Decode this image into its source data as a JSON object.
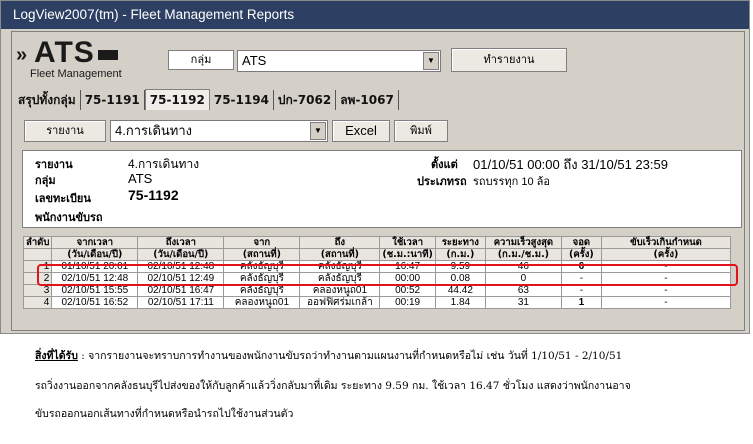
{
  "window": {
    "title": "LogView2007(tm) - Fleet Management Reports"
  },
  "logo": {
    "brand": "ATS",
    "subtitle": "Fleet Management"
  },
  "toolbar": {
    "group_label": "กลุ่ม",
    "group_value": "ATS",
    "make_report_label": "ทำรายงาน",
    "report_label": "รายงาน",
    "report_value": "4.การเดินทาง",
    "excel_label": "Excel",
    "print_label": "พิมพ์"
  },
  "tabs": [
    "สรุปทั้งกลุ่ม",
    "75-1191",
    "75-1192",
    "75-1194",
    "ปก-7062",
    "ลพ-1067"
  ],
  "active_tab": "75-1192",
  "info": {
    "report_key": "รายงาน",
    "report_val": "4.การเดินทาง",
    "group_key": "กลุ่ม",
    "group_val": "ATS",
    "plate_key": "เลขทะเบียน",
    "plate_val": "75-1192",
    "driver_key": "พนักงานขับรถ",
    "since_key": "ตั้งแต่",
    "since_val": "01/10/51  00:00 ถึง 31/10/51  23:59",
    "type_key": "ประเภทรถ",
    "type_val": "รถบรรทุก 10 ล้อ"
  },
  "table": {
    "headers_top": [
      "ลำดับ",
      "จากเวลา",
      "ถึงเวลา",
      "จาก",
      "ถึง",
      "ใช้เวลา",
      "ระยะทาง",
      "ความเร็วสูงสุด",
      "จอด",
      "ขับเร็วเกินกำหนด"
    ],
    "headers_bottom": [
      "",
      "(วัน/เดือน/ปี)",
      "(วัน/เดือน/ปี)",
      "(สถานที่)",
      "(สถานที่)",
      "(ช.ม.:นาที)",
      "(ก.ม.)",
      "(ก.ม./ช.ม.)",
      "(ครั้ง)",
      "(ครั้ง)"
    ],
    "rows": [
      [
        "1",
        "01/10/51  20:01",
        "02/10/51  12:48",
        "คลังธัญบุรี",
        "คลังธัญบุรี",
        "16:47",
        "9.59",
        "46",
        "6",
        "-"
      ],
      [
        "2",
        "02/10/51  12:48",
        "02/10/51  12:49",
        "คลังธัญบุรี",
        "คลังธัญบุรี",
        "00:00",
        "0.08",
        "0",
        "-",
        "-"
      ],
      [
        "3",
        "02/10/51  15:55",
        "02/10/51  16:47",
        "คลังธัญบุรี",
        "คลองหนูถ01",
        "00:52",
        "44.42",
        "63",
        "-",
        "-"
      ],
      [
        "4",
        "02/10/51  16:52",
        "02/10/51  17:11",
        "คลองหนูถ01",
        "ออฟฟิศร่มเกล้า",
        "00:19",
        "1.84",
        "31",
        "1",
        "-"
      ]
    ]
  },
  "note": {
    "title": "สิ่งที่ได้รับ",
    "line1": ": จากรายงานจะทราบการทำงานของพนักงานขับรถว่าทำงานตามแผนงานที่กำหนดหรือไม่ เช่น วันที่ 1/10/51 - 2/10/51",
    "line2": "รถวิ่งงานออกจากคลังธนบุรีไปส่งของให้กับลูกค้าแล้ววิ่งกลับมาที่เดิม ระยะทาง 9.59 กม. ใช้เวลา 16.47 ชั่วโมง แสดงว่าพนักงานอาจ",
    "line3": "ขับรถออกนอกเส้นทางที่กำหนดหรือนำรถไปใช้งานส่วนตัว"
  },
  "colors": {
    "titlebar": "#2d4063",
    "highlight": "#e0141a"
  }
}
